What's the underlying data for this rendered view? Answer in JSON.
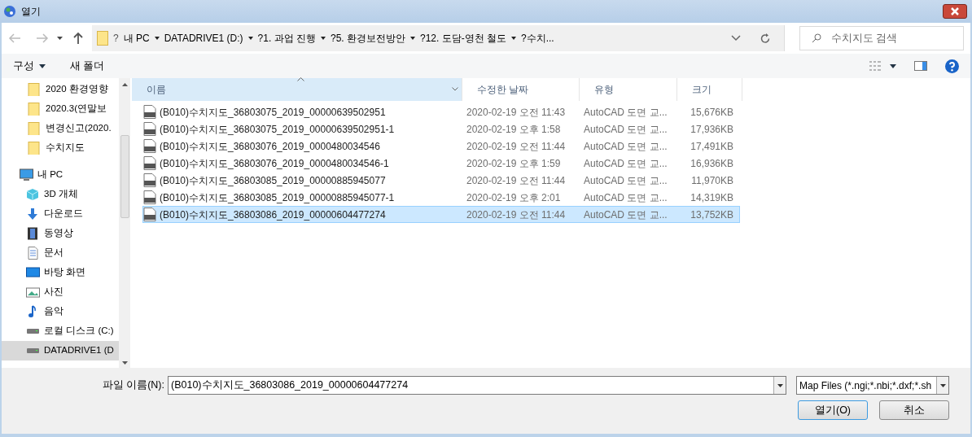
{
  "window": {
    "title": "열기"
  },
  "nav": {
    "breadcrumb": [
      {
        "label": "?",
        "dropdown": false
      },
      {
        "label": "내 PC",
        "dropdown": true
      },
      {
        "label": "DATADRIVE1 (D:)",
        "dropdown": true
      },
      {
        "label": "?1. 과업 진행",
        "dropdown": true
      },
      {
        "label": "?5. 환경보전방안",
        "dropdown": true
      },
      {
        "label": "?12. 도담-영천 철도",
        "dropdown": true
      },
      {
        "label": "?수치...",
        "dropdown": false
      }
    ],
    "search": {
      "placeholder": "수치지도 검색"
    }
  },
  "toolbar": {
    "organize": "구성",
    "new_folder": "새 폴더"
  },
  "sidebar": {
    "items": [
      {
        "kind": "folder",
        "label": "2020 환경영향",
        "selected": false
      },
      {
        "kind": "folder",
        "label": "2020.3(연말보",
        "selected": false
      },
      {
        "kind": "folder",
        "label": "변경신고(2020.",
        "selected": false
      },
      {
        "kind": "folder",
        "label": "수치지도",
        "selected": false
      },
      {
        "kind": "pc",
        "label": "내 PC",
        "selected": false
      },
      {
        "kind": "cube",
        "label": "3D 개체",
        "selected": false
      },
      {
        "kind": "download",
        "label": "다운로드",
        "selected": false
      },
      {
        "kind": "video",
        "label": "동영상",
        "selected": false
      },
      {
        "kind": "document",
        "label": "문서",
        "selected": false
      },
      {
        "kind": "desktop",
        "label": "바탕 화면",
        "selected": false
      },
      {
        "kind": "pictures",
        "label": "사진",
        "selected": false
      },
      {
        "kind": "music",
        "label": "음악",
        "selected": false
      },
      {
        "kind": "drive",
        "label": "로컬 디스크 (C:)",
        "selected": false
      },
      {
        "kind": "drive",
        "label": "DATADRIVE1 (D",
        "selected": true
      }
    ]
  },
  "table": {
    "columns": [
      {
        "label": "이름",
        "sorted": true
      },
      {
        "label": "수정한 날짜",
        "sorted": false
      },
      {
        "label": "유형",
        "sorted": false
      },
      {
        "label": "크기",
        "sorted": false
      }
    ],
    "rows": [
      {
        "name": "(B010)수치지도_36803075_2019_00000639502951",
        "date": "2020-02-19 오전 11:43",
        "type": "AutoCAD 도면 교...",
        "size": "15,676KB",
        "selected": false
      },
      {
        "name": "(B010)수치지도_36803075_2019_00000639502951-1",
        "date": "2020-02-19 오후 1:58",
        "type": "AutoCAD 도면 교...",
        "size": "17,936KB",
        "selected": false
      },
      {
        "name": "(B010)수치지도_36803076_2019_0000480034546",
        "date": "2020-02-19 오전 11:44",
        "type": "AutoCAD 도면 교...",
        "size": "17,491KB",
        "selected": false
      },
      {
        "name": "(B010)수치지도_36803076_2019_0000480034546-1",
        "date": "2020-02-19 오후 1:59",
        "type": "AutoCAD 도면 교...",
        "size": "16,936KB",
        "selected": false
      },
      {
        "name": "(B010)수치지도_36803085_2019_00000885945077",
        "date": "2020-02-19 오전 11:44",
        "type": "AutoCAD 도면 교...",
        "size": "11,970KB",
        "selected": false
      },
      {
        "name": "(B010)수치지도_36803085_2019_00000885945077-1",
        "date": "2020-02-19 오후 2:01",
        "type": "AutoCAD 도면 교...",
        "size": "14,319KB",
        "selected": false
      },
      {
        "name": "(B010)수치지도_36803086_2019_00000604477274",
        "date": "2020-02-19 오전 11:44",
        "type": "AutoCAD 도면 교...",
        "size": "13,752KB",
        "selected": true
      }
    ]
  },
  "footer": {
    "filename_label": "파일 이름(N):",
    "filename": "(B010)수치지도_36803086_2019_00000604477274",
    "filter": "Map Files (*.ngi;*.nbi;*.dxf;*.sh",
    "buttons": [
      {
        "label": "열기(O)",
        "default": true
      },
      {
        "label": "취소",
        "default": false
      }
    ]
  }
}
